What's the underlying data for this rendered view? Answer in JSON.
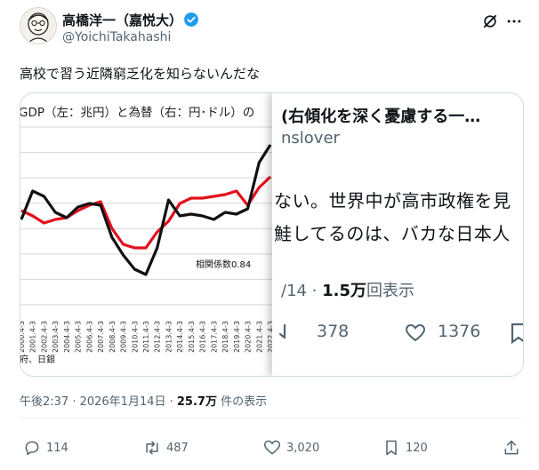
{
  "author": {
    "name": "高橋洋一（嘉悦大）",
    "handle": "@YoichiTakahashi"
  },
  "tweet": {
    "text": "高校で習う近隣窮乏化を知らないんだな"
  },
  "chart_data": {
    "type": "line",
    "title": "GDP（左：兆円）と為替（右：円･ドル）の",
    "annotation": "相関係数0.84",
    "source": "府、日銀",
    "categories": [
      "2000.4-3",
      "2001.4-3",
      "2002.4-3",
      "2003.4-3",
      "2004.4-3",
      "2005.4-3",
      "2006.4-3",
      "2007.4-3",
      "2008.4-3",
      "2009.4-3",
      "2010.4-3",
      "2011.4-3",
      "2012.4-3",
      "2013.4-3",
      "2014.4-3",
      "2015.4-3",
      "2016.4-3",
      "2017.4-3",
      "2018.4-3",
      "2019.4-3",
      "2020.4-3",
      "2021.4-3",
      "2022.4-3"
    ],
    "series": [
      {
        "color": "#e3101c",
        "values": [
          0.53,
          0.5,
          0.46,
          0.48,
          0.49,
          0.53,
          0.56,
          0.58,
          0.43,
          0.34,
          0.32,
          0.32,
          0.41,
          0.47,
          0.57,
          0.6,
          0.6,
          0.61,
          0.62,
          0.64,
          0.56,
          0.66,
          0.72
        ]
      },
      {
        "color": "#111111",
        "values": [
          0.48,
          0.64,
          0.61,
          0.52,
          0.49,
          0.55,
          0.57,
          0.56,
          0.38,
          0.28,
          0.2,
          0.17,
          0.32,
          0.59,
          0.5,
          0.51,
          0.5,
          0.48,
          0.52,
          0.51,
          0.54,
          0.8,
          0.9
        ]
      }
    ],
    "ylim": [
      0,
      1
    ],
    "grid": true
  },
  "quoted_behind": {
    "title": "(右傾化を深く憂慮する一…",
    "handle": "nslover",
    "line1": "ない。世界中が高市政権を見",
    "line2": "鮭してるのは、バカな日本人",
    "meta_prefix": "/14 · ",
    "meta_views": "1.5万",
    "meta_suffix": "回表示",
    "retweets": "378",
    "likes": "1376"
  },
  "meta": {
    "time_date": "午後2:37 · 2026年1月14日 · ",
    "views": "25.7万",
    "views_suffix": " 件の表示"
  },
  "actions": {
    "replies": "114",
    "reposts": "487",
    "likes": "3,020",
    "bookmarks": "120"
  },
  "colors": {
    "brand_blue": "#1d9bf0",
    "secondary_text": "#536471",
    "border": "#cfd9de"
  }
}
